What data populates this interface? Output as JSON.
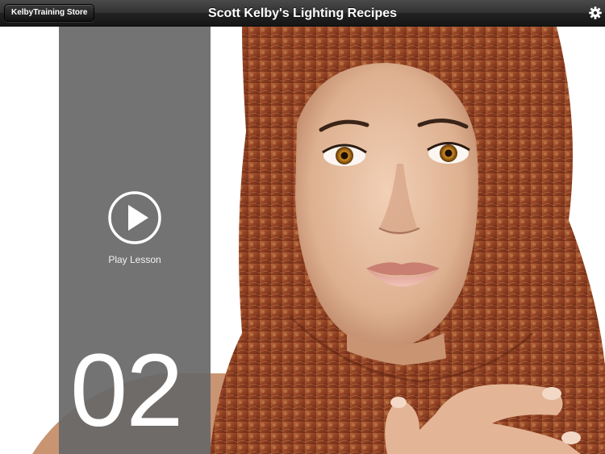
{
  "navbar": {
    "store_button_label": "KelbyTraining Store",
    "title": "Scott Kelby's Lighting Recipes",
    "settings_icon": "gear-icon"
  },
  "lesson": {
    "play_icon": "play-circle-icon",
    "play_label": "Play Lesson",
    "number": "02"
  },
  "colors": {
    "navbar": "#2a2a2a",
    "panel": "#686868",
    "text": "#ffffff"
  }
}
